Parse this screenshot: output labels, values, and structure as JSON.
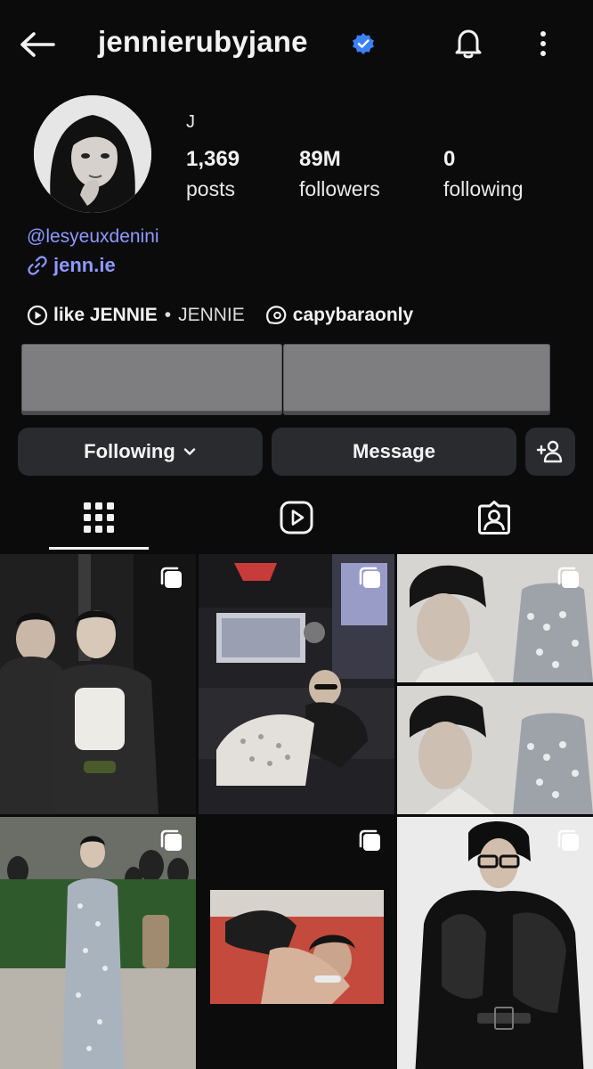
{
  "header": {
    "username": "jennierubyjane"
  },
  "icons": {
    "back": "arrow-left-icon",
    "verified": "verified-badge-icon",
    "bell": "bell-icon",
    "more": "more-vertical-icon",
    "link": "link-icon",
    "music": "play-circle-icon",
    "threads": "threads-icon",
    "chevron": "chevron-down-icon",
    "add_user": "add-user-icon",
    "grid": "grid-icon",
    "reels": "reels-icon",
    "tagged": "tagged-icon",
    "multi": "multiple-posts-icon"
  },
  "profile": {
    "display_name": "J",
    "stats": {
      "posts_value": "1,369",
      "posts_label": "posts",
      "followers_value": "89M",
      "followers_label": "followers",
      "following_value": "0",
      "following_label": "following"
    },
    "mention": "@lesyeuxdenini",
    "link": "jenn.ie",
    "music_song": "like JENNIE",
    "music_separator": "•",
    "music_artist": "JENNIE",
    "threads_handle": "capybaraonly"
  },
  "actions": {
    "following_label": "Following",
    "message_label": "Message"
  },
  "colors": {
    "background": "#0b0b0c",
    "link": "#8f99ff",
    "verified": "#3b82f6",
    "button_bg": "#2a2b2e"
  }
}
